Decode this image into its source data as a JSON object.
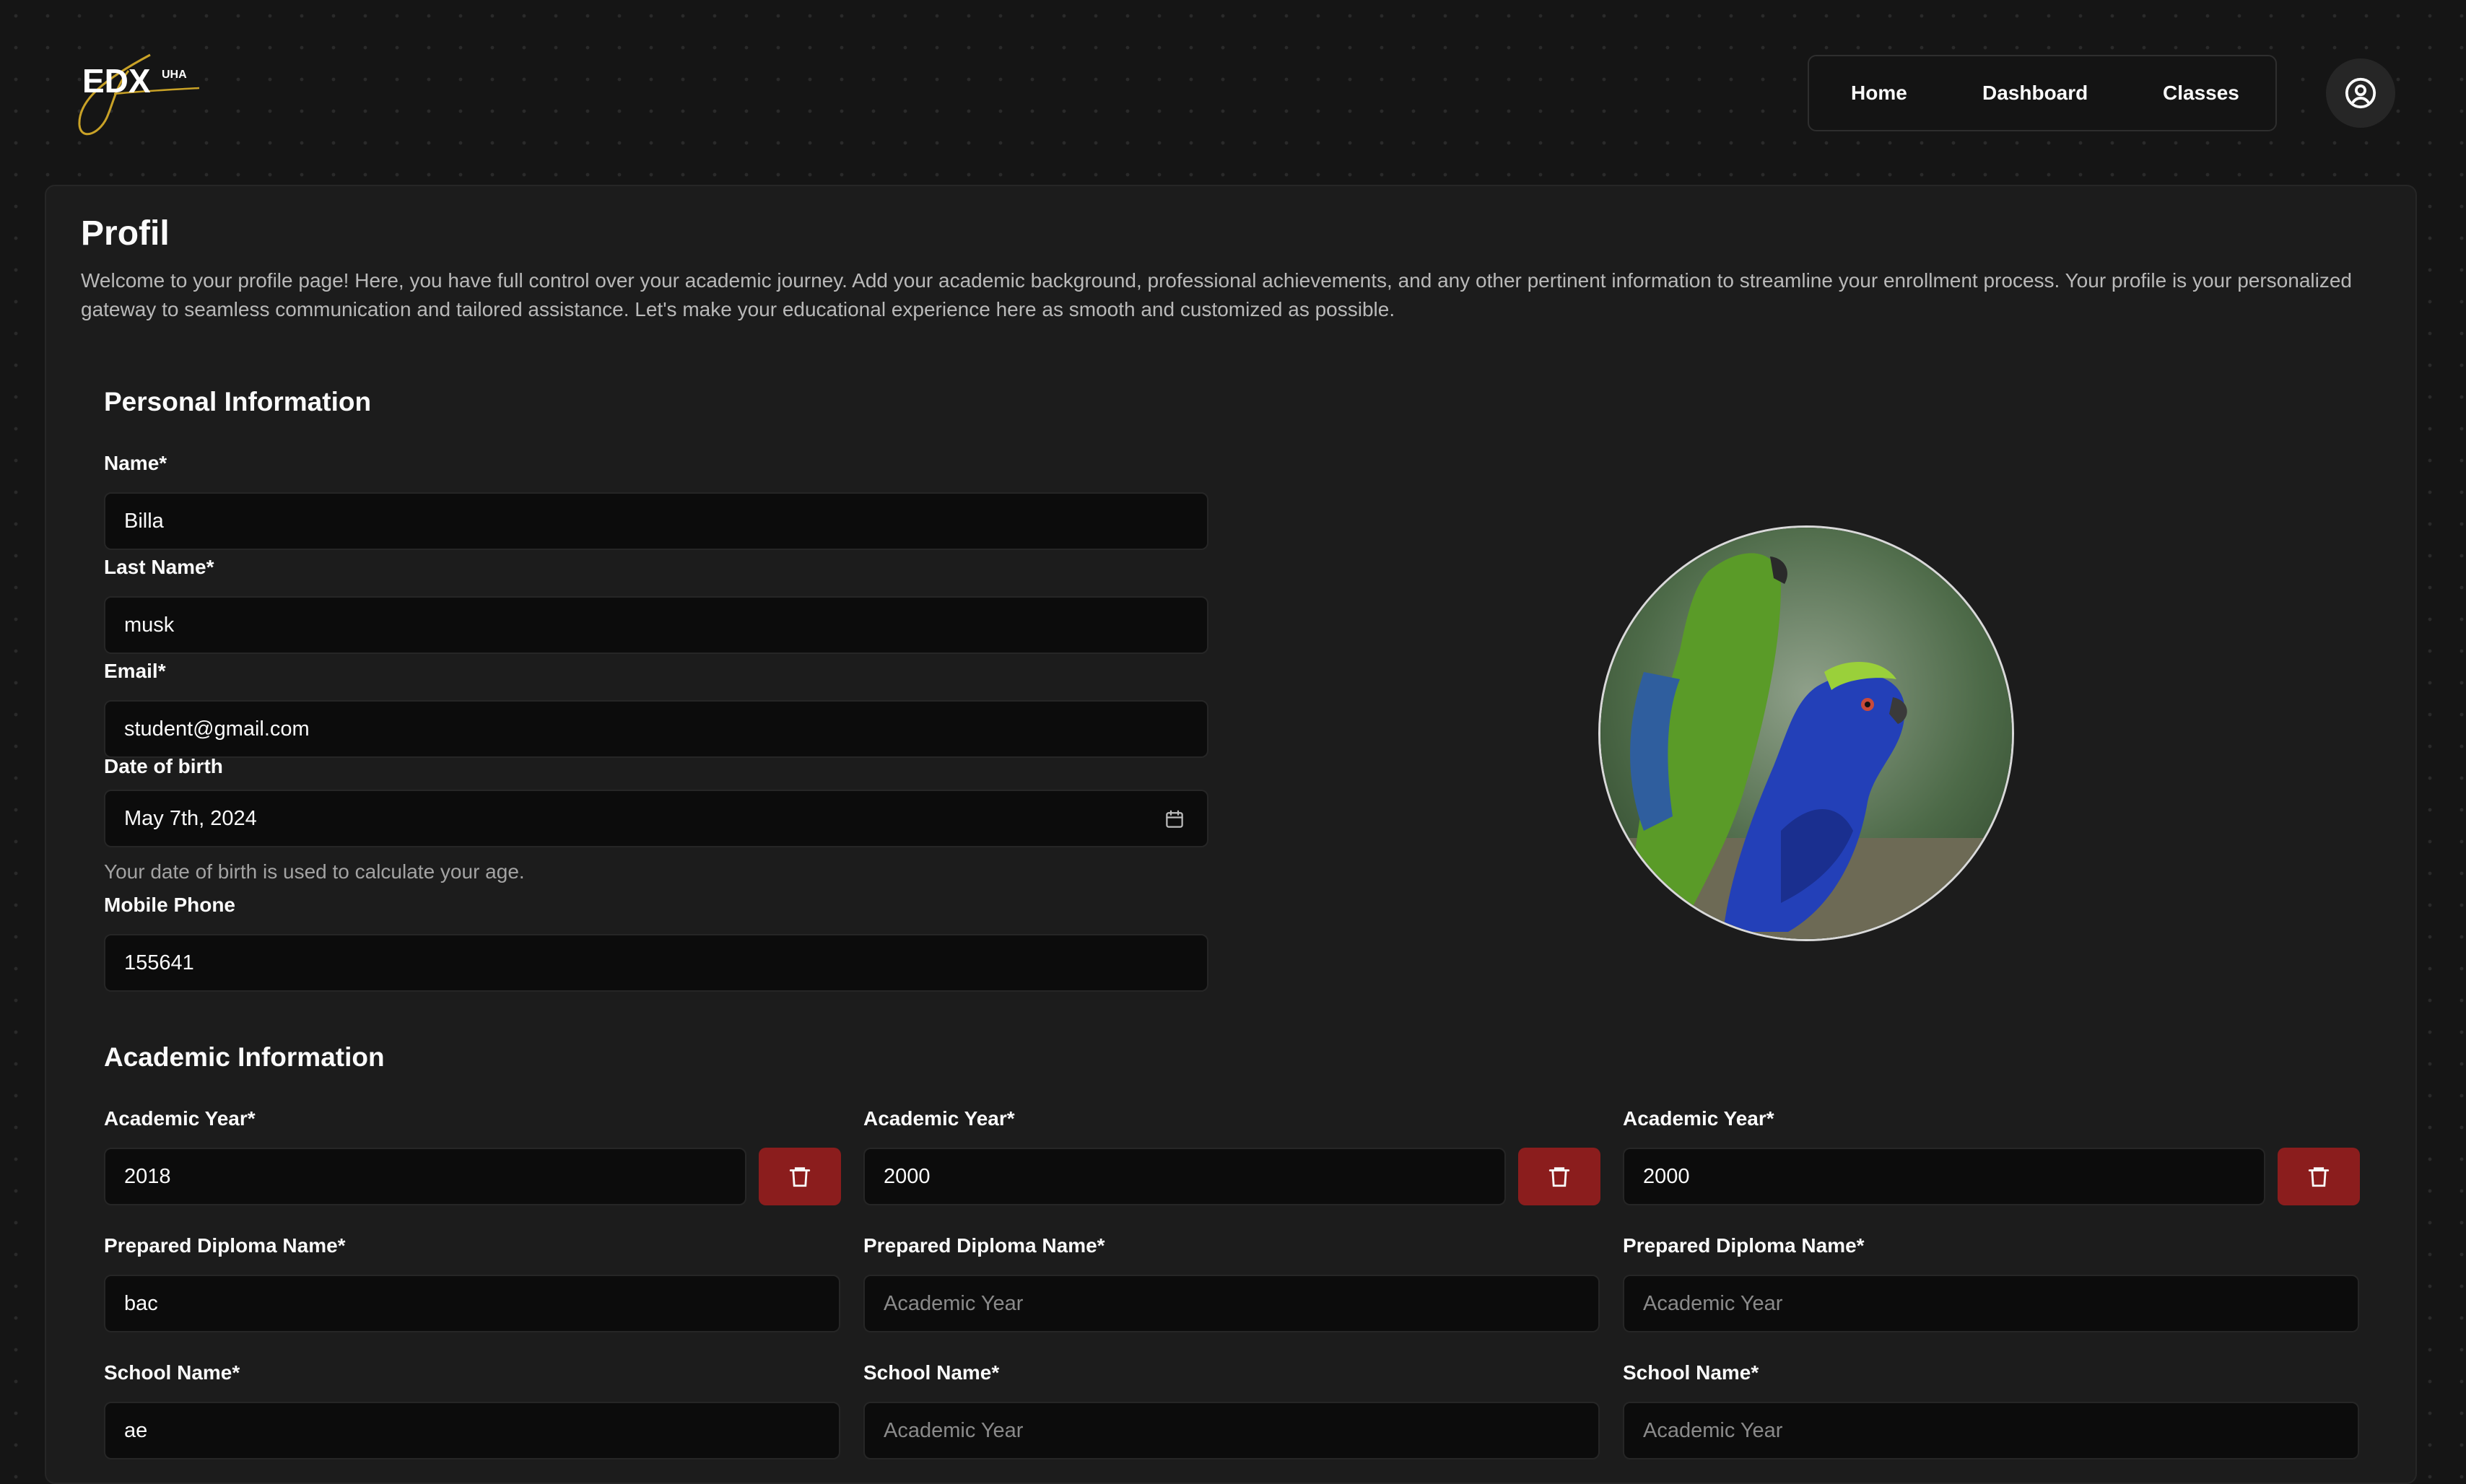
{
  "header": {
    "logo_text": "EDX",
    "logo_sup": "UHA",
    "nav": [
      "Home",
      "Dashboard",
      "Classes"
    ],
    "account_icon": "user-circle-icon"
  },
  "page": {
    "title": "Profil",
    "intro": "Welcome to your profile page! Here, you have full control over your academic journey. Add your academic background, professional achievements, and any other pertinent information to streamline your enrollment process. Your profile is your personalized gateway to seamless communication and tailored assistance. Let's make your educational experience here as smooth and customized as possible."
  },
  "personal": {
    "title": "Personal Information",
    "name_label": "Name*",
    "name_value": "Billa",
    "last_name_label": "Last Name*",
    "last_name_value": "musk",
    "email_label": "Email*",
    "email_value": "student@gmail.com",
    "dob_label": "Date of birth",
    "dob_value": "May 7th, 2024",
    "dob_icon": "calendar-icon",
    "dob_hint": "Your date of birth is used to calculate your age.",
    "phone_label": "Mobile Phone",
    "phone_value": "155641",
    "photo": "profile-photo-parrots"
  },
  "academic": {
    "title": "Academic Information",
    "delete_icon": "trash-icon",
    "delete_color": "#8b1d1d",
    "entries": [
      {
        "year_label": "Academic Year*",
        "year_value": "2018",
        "diploma_label": "Prepared Diploma Name*",
        "diploma_value": "bac",
        "diploma_placeholder": "",
        "school_label": "School Name*",
        "school_value": "ae",
        "school_placeholder": ""
      },
      {
        "year_label": "Academic Year*",
        "year_value": "2000",
        "diploma_label": "Prepared Diploma Name*",
        "diploma_value": "",
        "diploma_placeholder": "Academic Year",
        "school_label": "School Name*",
        "school_value": "",
        "school_placeholder": "Academic Year"
      },
      {
        "year_label": "Academic Year*",
        "year_value": "2000",
        "diploma_label": "Prepared Diploma Name*",
        "diploma_value": "",
        "diploma_placeholder": "Academic Year",
        "school_label": "School Name*",
        "school_value": "",
        "school_placeholder": "Academic Year"
      }
    ]
  }
}
